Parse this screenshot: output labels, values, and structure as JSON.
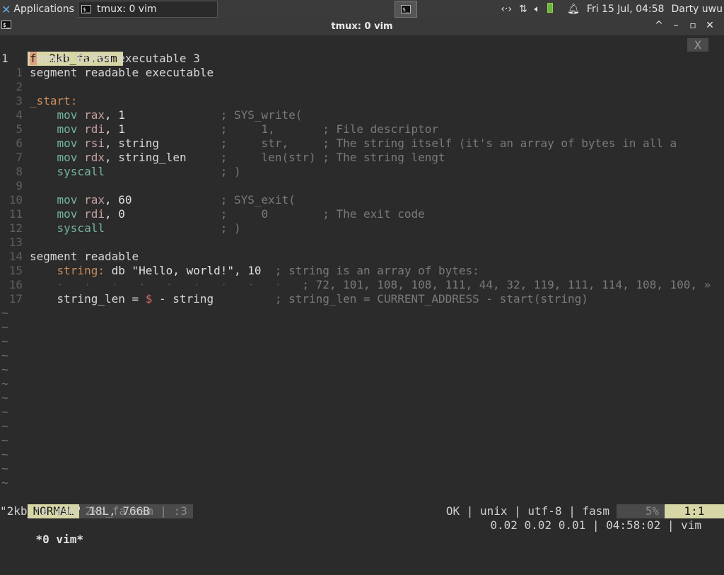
{
  "panel": {
    "apps_label": "Applications",
    "task_label": "tmux: 0 vim",
    "datetime": "Fri 15 Jul, 04:58",
    "user": "Darty uwu"
  },
  "window": {
    "title": "tmux: 0 vim",
    "btn_up": "^",
    "btn_min": "–",
    "btn_max": "▫",
    "btn_close": "✕"
  },
  "vim": {
    "tab_label": "1  2kb_fa.asm",
    "tab_close": "X",
    "cursor_char": "f",
    "line1_rest": "ormat ELF64 executable 3",
    "line_numbers": [
      "1",
      "1",
      "2",
      "3",
      "4",
      "5",
      "6",
      "7",
      "8",
      "9",
      "10",
      "11",
      "12",
      "13",
      "14",
      "15",
      "16",
      "17"
    ],
    "lines": {
      "l1b": "segment readable executable",
      "l3": "_start:",
      "l4": [
        "mov",
        "rax",
        ", 1",
        "; SYS_write("
      ],
      "l5": [
        "mov",
        "rdi",
        ", 1",
        ";     1,       ; File descriptor"
      ],
      "l6": [
        "mov",
        "rsi",
        ", string",
        ";     str,     ; The string itself (it's an array of bytes in all a"
      ],
      "l7": [
        "mov",
        "rdx",
        ", string_len",
        ";     len(str) ; The string lengt"
      ],
      "l8": [
        "syscall",
        "; )"
      ],
      "l10": [
        "mov",
        "rax",
        ", 60",
        "; SYS_exit("
      ],
      "l11": [
        "mov",
        "rdi",
        ", 0",
        ";     0        ; The exit code"
      ],
      "l12": [
        "syscall",
        "; )"
      ],
      "l14": "segment readable",
      "l15": [
        "string:",
        " db \"Hello, world!\", 10",
        "; string is an array of bytes:"
      ],
      "l16": [
        "·   ·   ·   ·   ·   ·   ·   ·   ·",
        "; 72, 101, 108, 108, 111, 44, 32, 119, 111, 114, 108, 100, »"
      ],
      "l17": [
        "string_len = ",
        "$",
        " - string",
        "; string_len = CURRENT_ADDRESS - start(string)"
      ]
    },
    "status": {
      "mode": "NORMAL",
      "file": "2kb_fa.asm | :3",
      "info": "OK | unix | utf-8 | fasm",
      "percent": "5%",
      "position": "1:1"
    },
    "message": "\"2kb_fa.asm\" 18L, 766B"
  },
  "tmux": {
    "window": "*0 vim*",
    "right": "0.02 0.02 0.01 | 04:58:02 | vim"
  }
}
